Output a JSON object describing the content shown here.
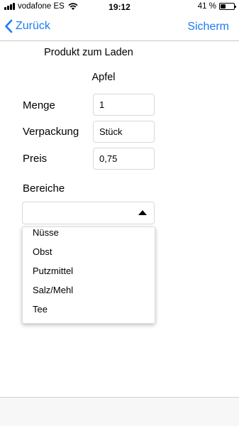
{
  "status_bar": {
    "carrier": "vodafone ES",
    "time": "19:12",
    "battery_text": "41 %",
    "battery_level": 0.41
  },
  "nav": {
    "back_label": "Zurück",
    "save_label": "Sicherm"
  },
  "form": {
    "title": "Produkt zum Laden",
    "product_name": "Apfel",
    "fields": [
      {
        "label": "Menge",
        "value": "1"
      },
      {
        "label": "Verpackung",
        "value": "Stück"
      },
      {
        "label": "Preis",
        "value": "0,75"
      }
    ],
    "section_label": "Bereiche",
    "select_value": ""
  },
  "dropdown": {
    "items": [
      "Nüsse",
      "Obst",
      "Putzmittel",
      "Salz/Mehl",
      "Tee"
    ]
  }
}
